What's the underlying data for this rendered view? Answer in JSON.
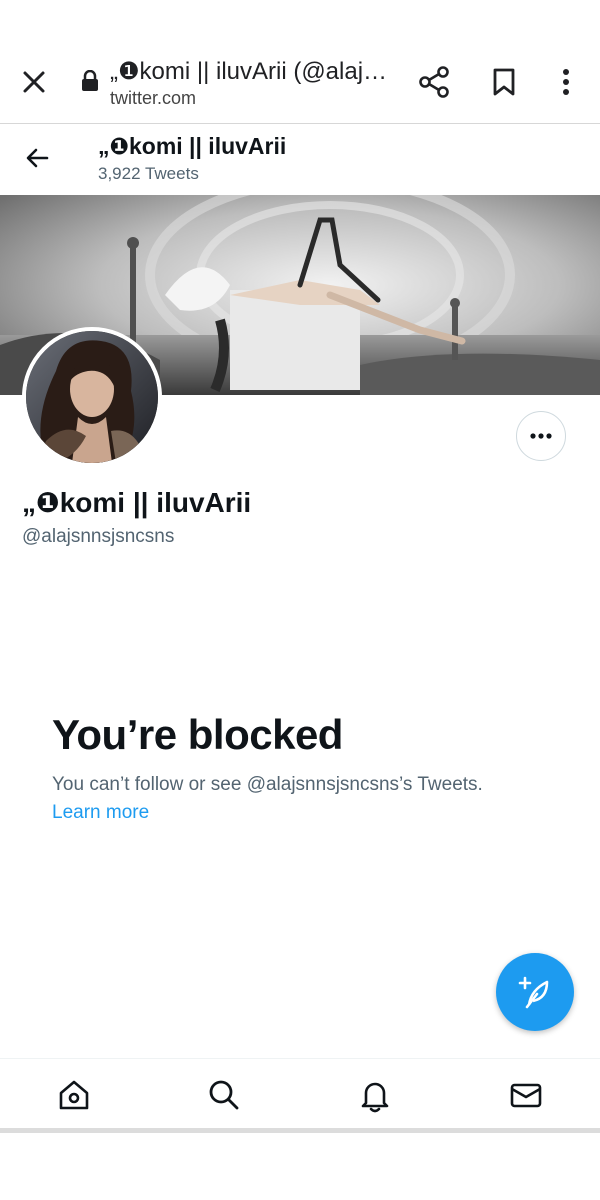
{
  "browser": {
    "title": "„❶komi || iluvArii (@alajs…",
    "url": "twitter.com"
  },
  "header": {
    "name": "„❶komi || iluvArii",
    "tweet_count": "3,922 Tweets"
  },
  "profile": {
    "name": "„❶komi || iluvArii",
    "handle": "@alajsnnsjsncsns"
  },
  "blocked": {
    "heading": "You’re blocked",
    "message": "You can’t follow or see @alajsnnsjsncsns’s Tweets.",
    "learn_more": "Learn more"
  },
  "nav": {
    "items": [
      "home-icon",
      "search-icon",
      "bell-icon",
      "mail-icon"
    ]
  },
  "colors": {
    "accent": "#1d9bf0",
    "text": "#0f1419",
    "muted": "#536471"
  }
}
